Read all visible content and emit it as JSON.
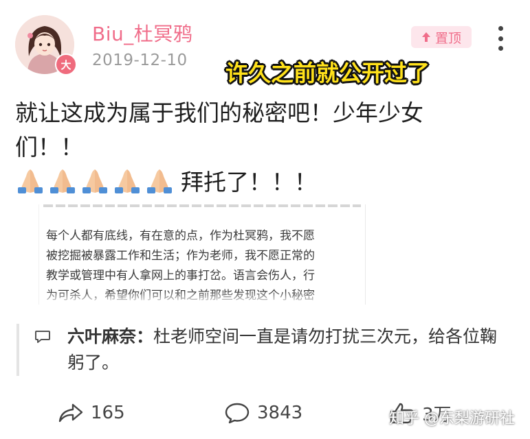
{
  "post": {
    "username": "Biu_杜冥鸦",
    "date": "2019-12-10",
    "avatar_badge": "大",
    "pin_label": "置顶",
    "body_line1": "就让这成为属于我们的秘密吧！少年少女",
    "body_line2": "们！！",
    "emoji_text": "拜托了！！！",
    "emoji_name": "folded-hands",
    "emoji_count": 5
  },
  "overlay_caption": "许久之前就公开过了",
  "embedded_screenshot": {
    "lines": [
      "每个人都有底线，有在意的点，作为杜冥鸦，我不愿",
      "被挖掘被暴露工作和生活；作为老师，我不愿正常的",
      "教学或管理中有人拿网上的事打岔。语言会伤人，行",
      "为可杀人，希望你们可以和之前那些发现这个小秘密"
    ]
  },
  "comment": {
    "author": "六叶麻奈：",
    "text": "杜老师空间一直是请勿打扰三次元，给各位鞠躬了。"
  },
  "actions": {
    "share_count": "165",
    "comment_count": "3843",
    "like_count": "3万"
  },
  "watermark": "知乎 @东梨游研社",
  "colors": {
    "username": "#f06d8a",
    "pin_bg": "#fde6ec",
    "caption": "#ffe11a",
    "badge": "#ef6b7d"
  }
}
